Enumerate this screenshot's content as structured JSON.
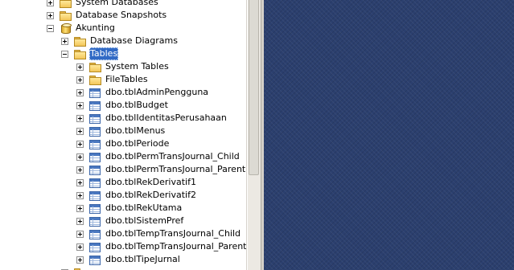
{
  "tree": {
    "system_databases": "System Databases",
    "database_snapshots": "Database Snapshots",
    "database": "Akunting",
    "database_diagrams": "Database Diagrams",
    "tables": "Tables",
    "system_tables": "System Tables",
    "file_tables": "FileTables",
    "table_items": [
      "dbo.tblAdminPengguna",
      "dbo.tblBudget",
      "dbo.tblIdentitasPerusahaan",
      "dbo.tblMenus",
      "dbo.tblPeriode",
      "dbo.tblPermTransJournal_Child",
      "dbo.tblPermTransJournal_Parent",
      "dbo.tblRekDerivatif1",
      "dbo.tblRekDerivatif2",
      "dbo.tblRekUtama",
      "dbo.tblSistemPref",
      "dbo.tblTempTransJournal_Child",
      "dbo.tblTempTransJournal_Parent",
      "dbo.tblTipeJurnal"
    ]
  },
  "colors": {
    "selection": "#316ac5",
    "workspace": "#2b3f6e"
  }
}
